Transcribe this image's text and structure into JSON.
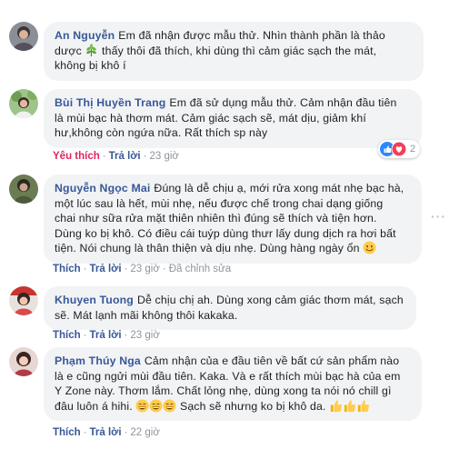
{
  "comments": [
    {
      "name": "An Nguyễn",
      "lines": [
        "Em đã nhận được mẫu thử. Nhìn thành phần là thảo",
        "dược",
        "thấy thôi đã thích, khi dùng thì cảm giác sạch the mát,",
        "không bị khô í"
      ],
      "actions": null
    },
    {
      "name": "Bùi Thị Huyền Trang",
      "lines": [
        "Em đã sử dụng mẫu thử. Cảm nhận đầu tiên",
        "là mùi bạc hà thơm mát. Cảm giác sạch sẽ, mát dịu, giảm khí",
        "hư,không còn ngứa nữa. Rất thích sp này"
      ],
      "actions": {
        "like": "Yêu thích",
        "reply": "Trả lời",
        "time": "23 giờ"
      },
      "reaction_count": "2"
    },
    {
      "name": "Nguyễn Ngọc Mai",
      "lines": [
        "Đúng là dễ chịu ạ, mới rửa xong mát nhẹ bạc hà,",
        "một lúc sau là hết, mùi nhẹ, nếu được chế trong chai dạng giống",
        "chai như sữa rửa mặt thiên nhiên thì đúng sẽ thích và tiện hơn.",
        "Dùng ko bị khô. Có điều cái tuýp dùng thưr lấy dung dịch ra hơi bất",
        "tiện. Nói chung là thân thiện và dịu nhẹ. Dùng hàng ngày ổn"
      ],
      "actions": {
        "like": "Thích",
        "reply": "Trả lời",
        "time": "23 giờ",
        "edited": "Đã chỉnh sửa"
      }
    },
    {
      "name": "Khuyen Tuong",
      "lines": [
        "Dễ chịu chị ah. Dùng xong cảm giác thơm mát, sạch",
        "sẽ. Mát lạnh mãi không thôi kakaka."
      ],
      "actions": {
        "like": "Thích",
        "reply": "Trả lời",
        "time": "23 giờ"
      }
    },
    {
      "name": "Phạm Thúy Nga",
      "lines": [
        "Cảm nhận của e đầu tiên về bất cứ sản phẩm nào",
        "là e cũng ngửi mùi đầu tiên. Kaka. Và e rất thích mùi bạc hà của em",
        "Y Zone này. Thơm lắm. Chất lỏng nhẹ, dùng xong ta nói nó chill gì",
        "đâu luôn á hihi.",
        "Sạch sẽ nhưng ko bị khô da."
      ],
      "actions": {
        "like": "Thích",
        "reply": "Trả lời",
        "time": "22 giờ"
      }
    }
  ],
  "colors": {
    "name": "#385898",
    "bubble": "#f2f3f5",
    "meta": "#90949c",
    "liked": "#e0245e"
  },
  "icons": [
    "herb-emoji",
    "like-reaction-icon",
    "love-reaction-icon",
    "smiling-emoji",
    "grinning-emoji",
    "thumbs-up-emoji",
    "more-options-icon"
  ]
}
